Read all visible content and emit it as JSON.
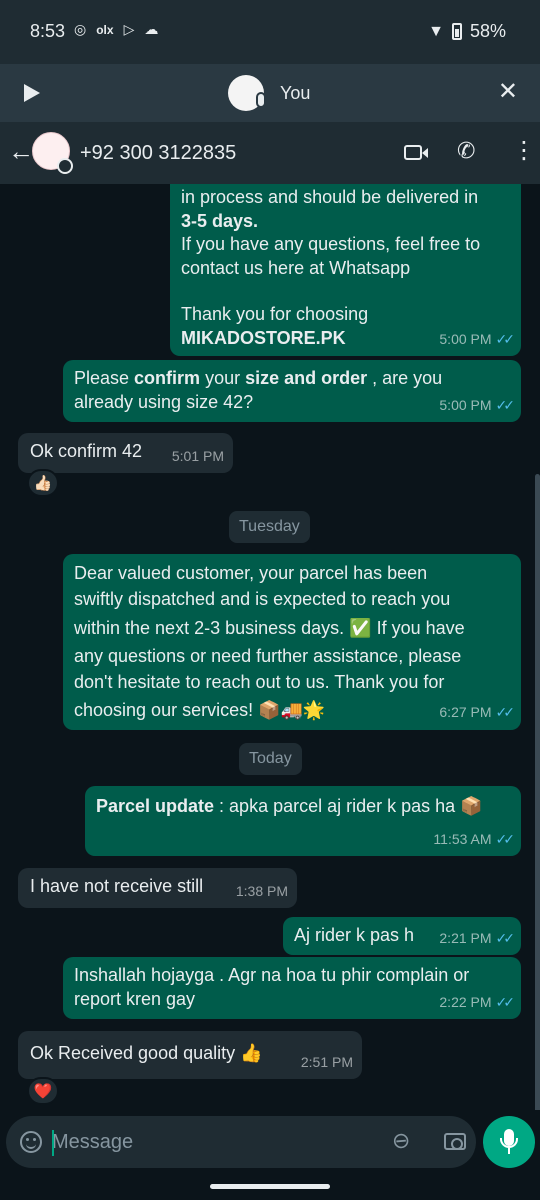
{
  "status_bar": {
    "time": "8:53",
    "battery": "58%"
  },
  "playback_bar": {
    "name": "You"
  },
  "chat_header": {
    "title": "+92 300 3122835"
  },
  "messages": [
    {
      "direction": "outgoing",
      "line1": "in process and should be delivered in",
      "line2_bold": "3-5 days.",
      "line3": "If you have any questions, feel free to",
      "line4": "contact us here at Whatsapp",
      "line5": "Thank you for choosing",
      "line6_bold": "MIKADOSTORE.PK",
      "time": "5:00 PM"
    },
    {
      "direction": "outgoing",
      "part1": "Please ",
      "bold1": "confirm",
      "part2": " your ",
      "bold2": "size and order",
      "part3": " , are you",
      "line2": "already using size 42?",
      "time": "5:00 PM"
    },
    {
      "direction": "incoming",
      "text": "Ok confirm 42",
      "time": "5:01 PM",
      "reaction": "👍🏻"
    },
    {
      "direction": "outgoing",
      "line1": "Dear valued customer, your parcel has been",
      "line2": "swiftly dispatched and is expected to reach you",
      "line3": "within the next 2-3 business days. ✅ If you have",
      "line4": "any questions or need further assistance, please",
      "line5": "don't hesitate to reach out to us. Thank you for",
      "line6": "choosing our services! 📦🚚🌟",
      "time": "6:27 PM"
    },
    {
      "direction": "outgoing",
      "bold": "Parcel update",
      "text": " : apka parcel aj rider k pas ha 📦",
      "time": "11:53 AM"
    },
    {
      "direction": "incoming",
      "text": "I have not receive still",
      "time": "1:38 PM"
    },
    {
      "direction": "outgoing",
      "text": "Aj rider k pas h",
      "time": "2:21 PM"
    },
    {
      "direction": "outgoing",
      "line1": "Inshallah hojayga . Agr na hoa tu phir complain or",
      "line2": "report kren gay",
      "time": "2:22 PM"
    },
    {
      "direction": "incoming",
      "text": "Ok Received good quality 👍",
      "time": "2:51 PM",
      "reaction": "❤️"
    }
  ],
  "date_chips": {
    "tuesday": "Tuesday",
    "today": "Today"
  },
  "ticks": "✓✓",
  "composer": {
    "placeholder": "Message"
  },
  "colors": {
    "outgoing_bubble": "#005c4b",
    "incoming_bubble": "#202c33",
    "accent": "#00a884",
    "read_ticks": "#53bdeb"
  }
}
